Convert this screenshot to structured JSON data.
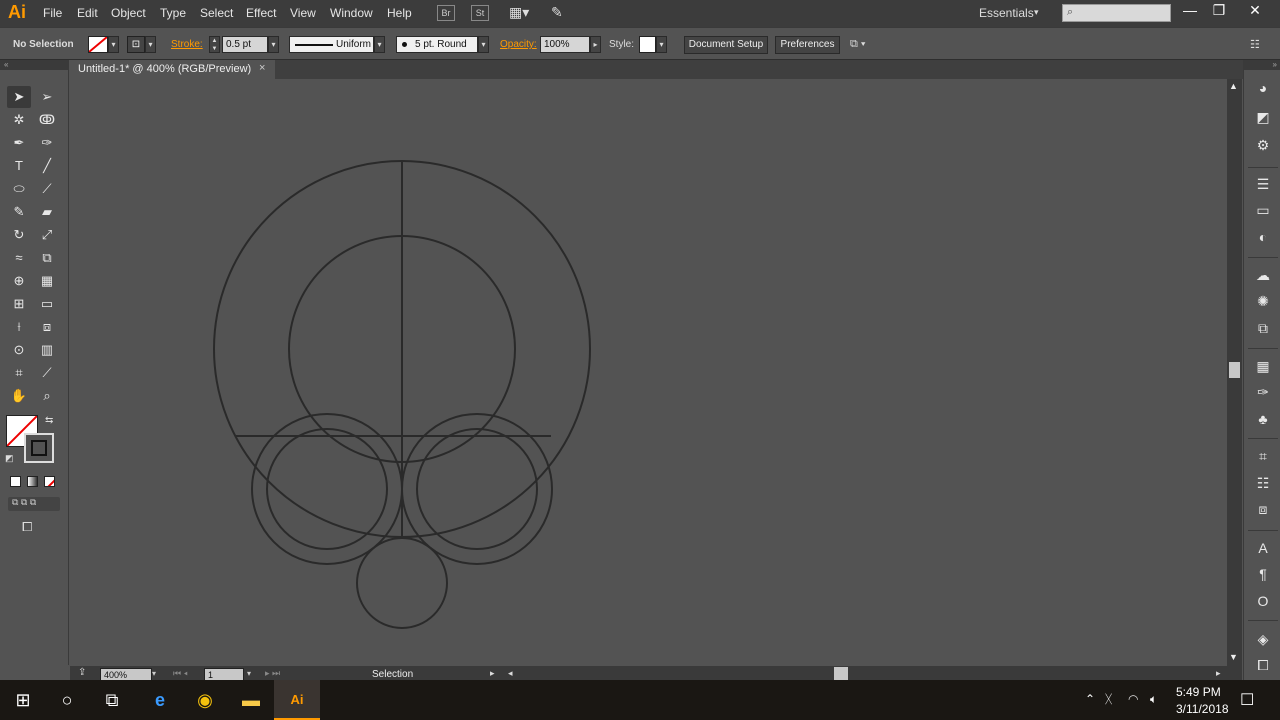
{
  "app": {
    "logo": "Ai",
    "accent": "#ff9a00"
  },
  "menu": [
    "File",
    "Edit",
    "Object",
    "Type",
    "Select",
    "Effect",
    "View",
    "Window",
    "Help"
  ],
  "bridge": {
    "br_label": "Br",
    "st_label": "St"
  },
  "workspace": {
    "label": "Essentials"
  },
  "control_bar": {
    "selection_label": "No Selection",
    "stroke_label": "Stroke:",
    "stroke_value": "0.5 pt",
    "profile_label": "Uniform",
    "brush_label": "5 pt. Round",
    "opacity_label": "Opacity:",
    "opacity_value": "100%",
    "style_label": "Style:",
    "document_setup_label": "Document Setup",
    "preferences_label": "Preferences"
  },
  "document": {
    "tab_title": "Untitled-1* @ 400% (RGB/Preview)",
    "close_glyph": "×"
  },
  "status_bar": {
    "zoom": "400%",
    "artboard": "1",
    "tool_name": "Selection"
  },
  "tools": [
    {
      "name": "selection-tool-icon",
      "glyph": "➤"
    },
    {
      "name": "direct-selection-tool-icon",
      "glyph": "➢"
    },
    {
      "name": "magic-wand-tool-icon",
      "glyph": "✲"
    },
    {
      "name": "lasso-tool-icon",
      "glyph": "ↂ"
    },
    {
      "name": "pen-tool-icon",
      "glyph": "✒"
    },
    {
      "name": "curvature-tool-icon",
      "glyph": "✑"
    },
    {
      "name": "type-tool-icon",
      "glyph": "T"
    },
    {
      "name": "line-segment-tool-icon",
      "glyph": "╱"
    },
    {
      "name": "ellipse-tool-icon",
      "glyph": "⬭"
    },
    {
      "name": "paintbrush-tool-icon",
      "glyph": "⟋"
    },
    {
      "name": "shaper-tool-icon",
      "glyph": "✎"
    },
    {
      "name": "eraser-tool-icon",
      "glyph": "▰"
    },
    {
      "name": "rotate-tool-icon",
      "glyph": "↻"
    },
    {
      "name": "scale-tool-icon",
      "glyph": "⤢"
    },
    {
      "name": "warp-tool-icon",
      "glyph": "≈"
    },
    {
      "name": "free-transform-tool-icon",
      "glyph": "⧉"
    },
    {
      "name": "shape-builder-tool-icon",
      "glyph": "⊕"
    },
    {
      "name": "perspective-grid-tool-icon",
      "glyph": "▦"
    },
    {
      "name": "mesh-tool-icon",
      "glyph": "⊞"
    },
    {
      "name": "gradient-tool-icon",
      "glyph": "▭"
    },
    {
      "name": "eyedropper-tool-icon",
      "glyph": "⟊"
    },
    {
      "name": "blend-tool-icon",
      "glyph": "⧈"
    },
    {
      "name": "symbol-sprayer-tool-icon",
      "glyph": "⊙"
    },
    {
      "name": "column-graph-tool-icon",
      "glyph": "▥"
    },
    {
      "name": "artboard-tool-icon",
      "glyph": "⌗"
    },
    {
      "name": "slice-tool-icon",
      "glyph": "⟋"
    },
    {
      "name": "hand-tool-icon",
      "glyph": "✋"
    },
    {
      "name": "zoom-tool-icon",
      "glyph": "⌕"
    }
  ],
  "dock": [
    {
      "name": "color-panel-icon",
      "glyph": "◕"
    },
    {
      "name": "color-guide-panel-icon",
      "glyph": "◩"
    },
    {
      "name": "css-properties-panel-icon",
      "glyph": "⚙"
    },
    {
      "name": "stroke-panel-icon",
      "glyph": "☰"
    },
    {
      "name": "gradient-panel-icon",
      "glyph": "▭"
    },
    {
      "name": "transparency-panel-icon",
      "glyph": "◐"
    },
    {
      "name": "libraries-panel-icon",
      "glyph": "☁"
    },
    {
      "name": "symbols-panel-icon",
      "glyph": "✺"
    },
    {
      "name": "asset-export-panel-icon",
      "glyph": "⧉"
    },
    {
      "name": "swatches-panel-icon",
      "glyph": "▦"
    },
    {
      "name": "brushes-panel-icon",
      "glyph": "✑"
    },
    {
      "name": "graphic-styles-panel-icon",
      "glyph": "♣"
    },
    {
      "name": "transform-panel-icon",
      "glyph": "⌗"
    },
    {
      "name": "align-panel-icon",
      "glyph": "☷"
    },
    {
      "name": "pathfinder-panel-icon",
      "glyph": "⧈"
    },
    {
      "name": "character-panel-icon",
      "glyph": "A"
    },
    {
      "name": "paragraph-panel-icon",
      "glyph": "¶"
    },
    {
      "name": "opentype-panel-icon",
      "glyph": "O"
    },
    {
      "name": "layers-panel-icon",
      "glyph": "◈"
    },
    {
      "name": "artboards-panel-icon",
      "glyph": "⧠"
    }
  ],
  "taskbar": {
    "time": "5:49 PM",
    "date": "3/11/2018"
  }
}
